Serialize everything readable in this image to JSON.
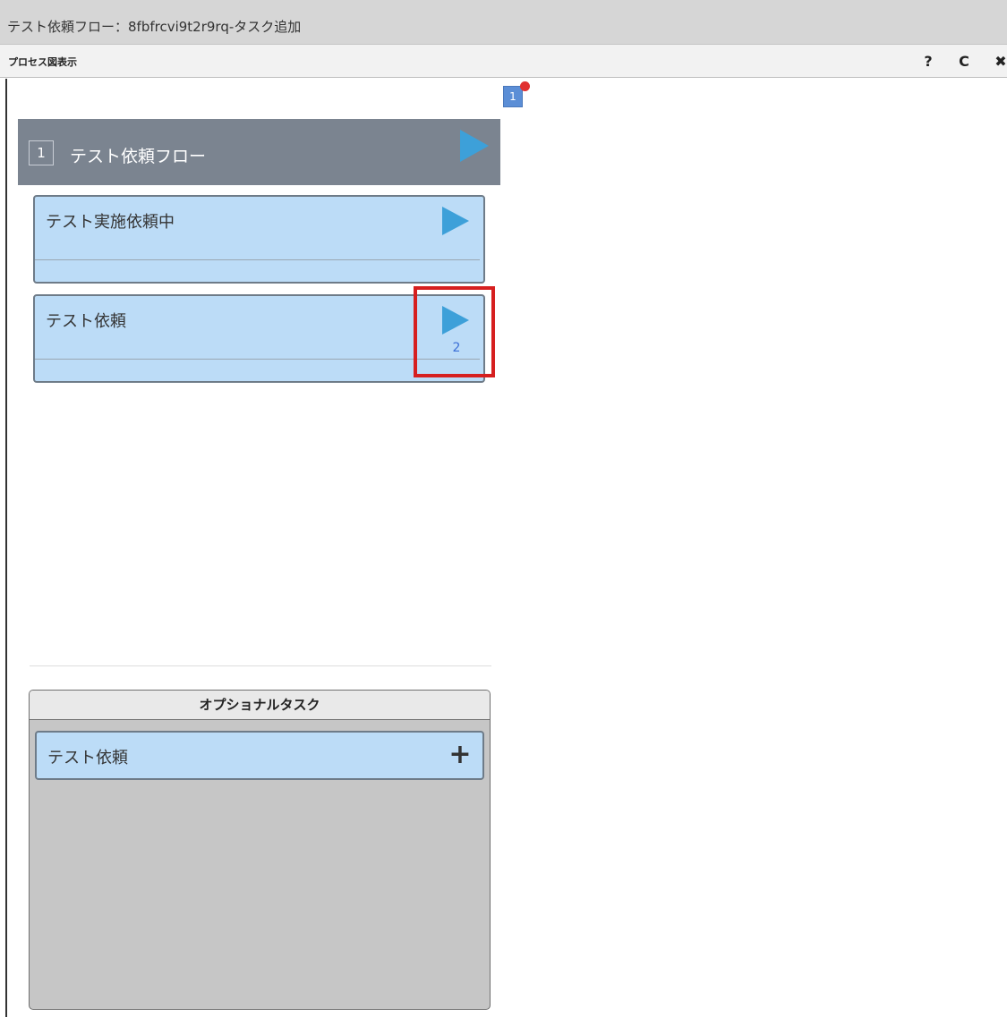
{
  "window": {
    "title": "テスト依頼フロー：8fbfrcvi9t2r9rq-タスク追加"
  },
  "toolbar": {
    "label": "プロセス図表示",
    "help_glyph": "?",
    "refresh_glyph": "C",
    "close_glyph": "✖"
  },
  "badge": {
    "count": "1"
  },
  "flow": {
    "number": "1",
    "title": "テスト依頼フロー"
  },
  "tasks": [
    {
      "title": "テスト実施依頼中",
      "count": ""
    },
    {
      "title": "テスト依頼",
      "count": "2"
    }
  ],
  "optional": {
    "header": "オプショナルタスク",
    "items": [
      {
        "title": "テスト依頼",
        "action_glyph": "+"
      }
    ]
  },
  "colors": {
    "accent_play": "#3da0d9",
    "task_bg": "#bcdcf7",
    "flow_header_bg": "#7b8490",
    "highlight": "#d61f1f",
    "badge_bg": "#5b8ed6",
    "badge_dot": "#e03030"
  },
  "icons": {
    "help": "question-mark-icon",
    "refresh": "refresh-icon",
    "close": "close-icon",
    "play": "play-icon",
    "add": "plus-icon"
  }
}
